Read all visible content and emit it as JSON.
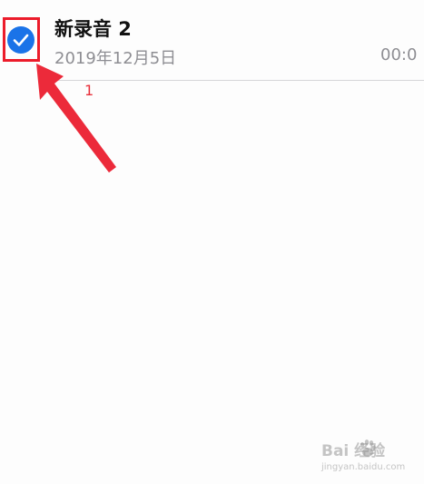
{
  "recording": {
    "title": "新录音 2",
    "date": "2019年12月5日",
    "duration": "00:0",
    "selected": true
  },
  "annotation": {
    "number": "1"
  },
  "watermark": {
    "brand": "Bai  经验",
    "site": "jingyan.baidu.com"
  },
  "colors": {
    "accent": "#1a73e8",
    "highlight": "#ec1c2b",
    "secondary_text": "#8e8e93"
  },
  "icons": {
    "check": "checkmark-circle-icon",
    "arrow": "annotation-arrow-icon",
    "paw": "baidu-paw-icon"
  }
}
